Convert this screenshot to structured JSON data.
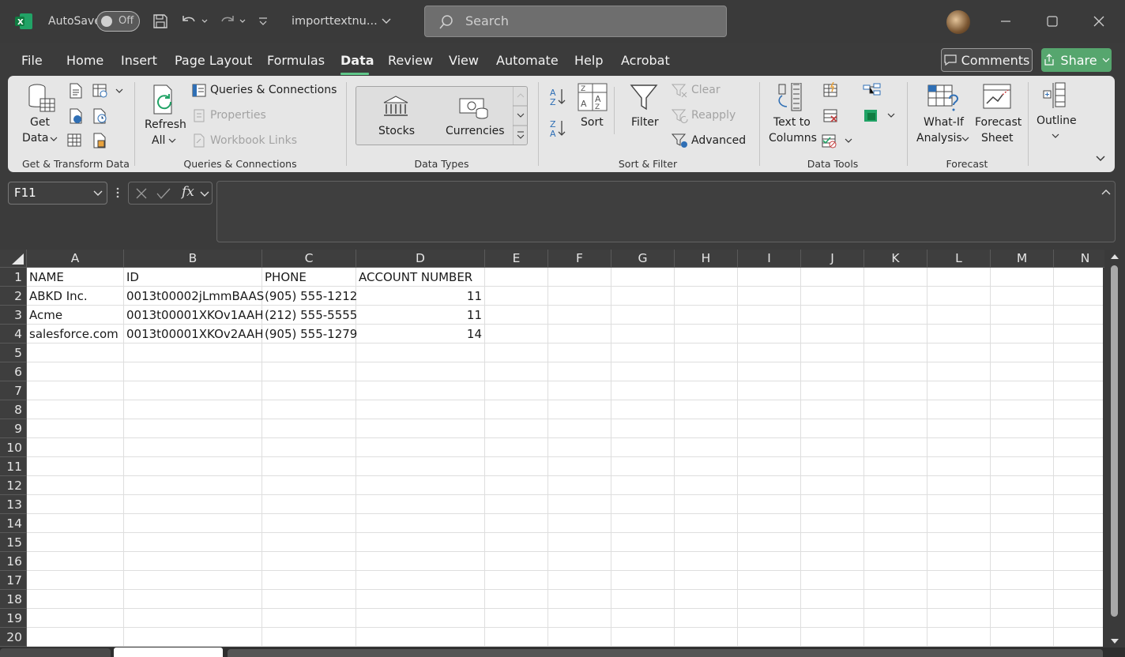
{
  "titlebar": {
    "autosave_label": "AutoSave",
    "toggle_state": "Off",
    "filename": "importtextnu...",
    "search_placeholder": "Search"
  },
  "menu": [
    "File",
    "Home",
    "Insert",
    "Page Layout",
    "Formulas",
    "Data",
    "Review",
    "View",
    "Automate",
    "Help",
    "Acrobat"
  ],
  "active_tab": "Data",
  "top_buttons": {
    "comments": "Comments",
    "share": "Share"
  },
  "ribbon": {
    "get_transform": {
      "get_data_1": "Get",
      "get_data_2": "Data",
      "group": "Get & Transform Data"
    },
    "queries": {
      "refresh_1": "Refresh",
      "refresh_2": "All",
      "queries_connections": "Queries & Connections",
      "properties": "Properties",
      "workbook_links": "Workbook Links",
      "group": "Queries & Connections"
    },
    "data_types": {
      "stocks": "Stocks",
      "currencies": "Currencies",
      "group": "Data Types"
    },
    "sort_filter": {
      "sort": "Sort",
      "filter": "Filter",
      "clear": "Clear",
      "reapply": "Reapply",
      "advanced": "Advanced",
      "group": "Sort & Filter"
    },
    "data_tools": {
      "text_1": "Text to",
      "text_2": "Columns",
      "group": "Data Tools"
    },
    "forecast": {
      "whatif_1": "What-If",
      "whatif_2": "Analysis",
      "sheet_1": "Forecast",
      "sheet_2": "Sheet",
      "group": "Forecast"
    },
    "outline": {
      "label": "Outline"
    }
  },
  "formula_bar": {
    "name_box": "F11",
    "fx": "fx",
    "formula": ""
  },
  "sheet": {
    "columns": [
      "A",
      "B",
      "C",
      "D",
      "E",
      "F",
      "G",
      "H",
      "I",
      "J",
      "K",
      "L",
      "M",
      "N"
    ],
    "rows": [
      "1",
      "2",
      "3",
      "4",
      "5",
      "6",
      "7",
      "8",
      "9",
      "10",
      "11",
      "12",
      "13",
      "14",
      "15",
      "16",
      "17",
      "18",
      "19",
      "20"
    ],
    "data": [
      [
        "NAME",
        "ID",
        "PHONE",
        "ACCOUNT NUMBER"
      ],
      [
        "ABKD Inc.",
        "0013t00002jLmmBAAS",
        "(905) 555-1212",
        "11"
      ],
      [
        "Acme",
        "0013t00001XKOv1AAH",
        "(212) 555-5555",
        "11"
      ],
      [
        "salesforce.com",
        "0013t00001XKOv2AAH",
        "(905) 555-1279",
        "14"
      ]
    ]
  },
  "colors": {
    "accent": "#5fc689",
    "share_bg": "#56a66e",
    "ribbon_bg": "#e6e6e6",
    "title_bg": "#3a3a3a"
  }
}
